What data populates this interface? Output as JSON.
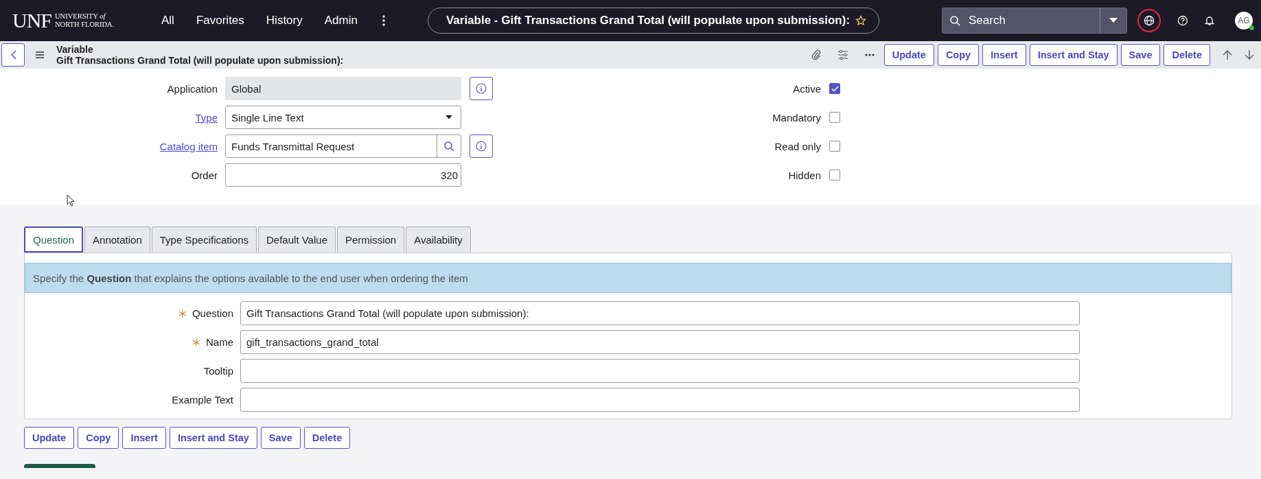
{
  "top_bar": {
    "logo": {
      "mark": "UNF",
      "line_1": "UNIVERSITY *of*",
      "line_2": "NORTH FLORIDA."
    },
    "nav": [
      "All",
      "Favorites",
      "History",
      "Admin"
    ],
    "record_title": "Variable - Gift Transactions Grand Total (will populate upon submission):",
    "search": {
      "placeholder": "Search"
    },
    "avatar": "AG"
  },
  "record_header": {
    "table": "Variable",
    "title": "Gift Transactions Grand Total (will populate upon submission):",
    "buttons": [
      "Update",
      "Copy",
      "Insert",
      "Insert and Stay",
      "Save",
      "Delete"
    ]
  },
  "form": {
    "fields": [
      {
        "label": "Application",
        "kind": "readonly",
        "value": "Global",
        "link": false,
        "info": true
      },
      {
        "label": "Type",
        "kind": "select",
        "value": "Single Line Text",
        "link": true,
        "info": false
      },
      {
        "label": "Catalog item",
        "kind": "reference",
        "value": "Funds Transmittal Request",
        "link": true,
        "info": true
      },
      {
        "label": "Order",
        "kind": "number",
        "value": "320",
        "link": false,
        "info": false
      }
    ],
    "checks": [
      {
        "label": "Active",
        "checked": true
      },
      {
        "label": "Mandatory",
        "checked": false
      },
      {
        "label": "Read only",
        "checked": false
      },
      {
        "label": "Hidden",
        "checked": false
      }
    ]
  },
  "tabs": [
    {
      "label": "Question",
      "selected": true
    },
    {
      "label": "Annotation",
      "selected": false
    },
    {
      "label": "Type Specifications",
      "selected": false
    },
    {
      "label": "Default Value",
      "selected": false
    },
    {
      "label": "Permission",
      "selected": false
    },
    {
      "label": "Availability",
      "selected": false
    }
  ],
  "tab_panel": {
    "info": "Specify the **Question** that explains the options available to the end user when ordering the item",
    "fields": [
      {
        "label": "Question",
        "required": true,
        "value": "Gift Transactions Grand Total (will populate upon submission):"
      },
      {
        "label": "Name",
        "required": true,
        "value": "gift_transactions_grand_total"
      },
      {
        "label": "Tooltip",
        "required": false
      },
      {
        "label": "Example Text",
        "required": false
      }
    ]
  },
  "bottom_buttons": [
    "Update",
    "Copy",
    "Insert",
    "Insert and Stay",
    "Save",
    "Delete"
  ]
}
